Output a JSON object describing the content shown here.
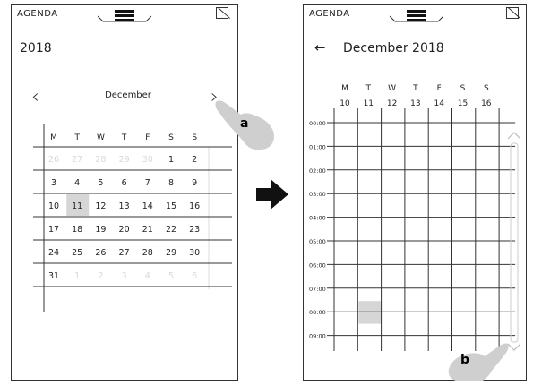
{
  "left_screen": {
    "app_title": "AGENDA",
    "year": "2018",
    "month": "December",
    "prev_glyph": "‹",
    "next_glyph": "›",
    "weekdays": [
      "M",
      "T",
      "W",
      "T",
      "F",
      "S",
      "S"
    ],
    "weeks": [
      [
        "26",
        "27",
        "28",
        "29",
        "30",
        "1",
        "2"
      ],
      [
        "3",
        "4",
        "5",
        "6",
        "7",
        "8",
        "9"
      ],
      [
        "10",
        "11",
        "12",
        "13",
        "14",
        "15",
        "16"
      ],
      [
        "17",
        "18",
        "19",
        "20",
        "21",
        "22",
        "23"
      ],
      [
        "24",
        "25",
        "26",
        "27",
        "28",
        "29",
        "30"
      ],
      [
        "31",
        "1",
        "2",
        "3",
        "4",
        "5",
        "6"
      ]
    ],
    "selected_day": "11",
    "tap_label": "a"
  },
  "right_screen": {
    "app_title": "AGENDA",
    "back_glyph": "←",
    "title": "December 2018",
    "weekdays": [
      "M",
      "T",
      "W",
      "T",
      "F",
      "S",
      "S"
    ],
    "dates": [
      "10",
      "11",
      "12",
      "13",
      "14",
      "15",
      "16"
    ],
    "hours": [
      "00:00",
      "01:00",
      "02:00",
      "03:00",
      "04:00",
      "05:00",
      "06:00",
      "07:00",
      "08:00",
      "09:00"
    ],
    "highlight": {
      "day": "11",
      "hour": "08:00"
    },
    "tap_label": "b"
  },
  "colors": {
    "highlight": "#d6d6d6",
    "faded_text": "#d8d8d8",
    "line": "#333333"
  }
}
